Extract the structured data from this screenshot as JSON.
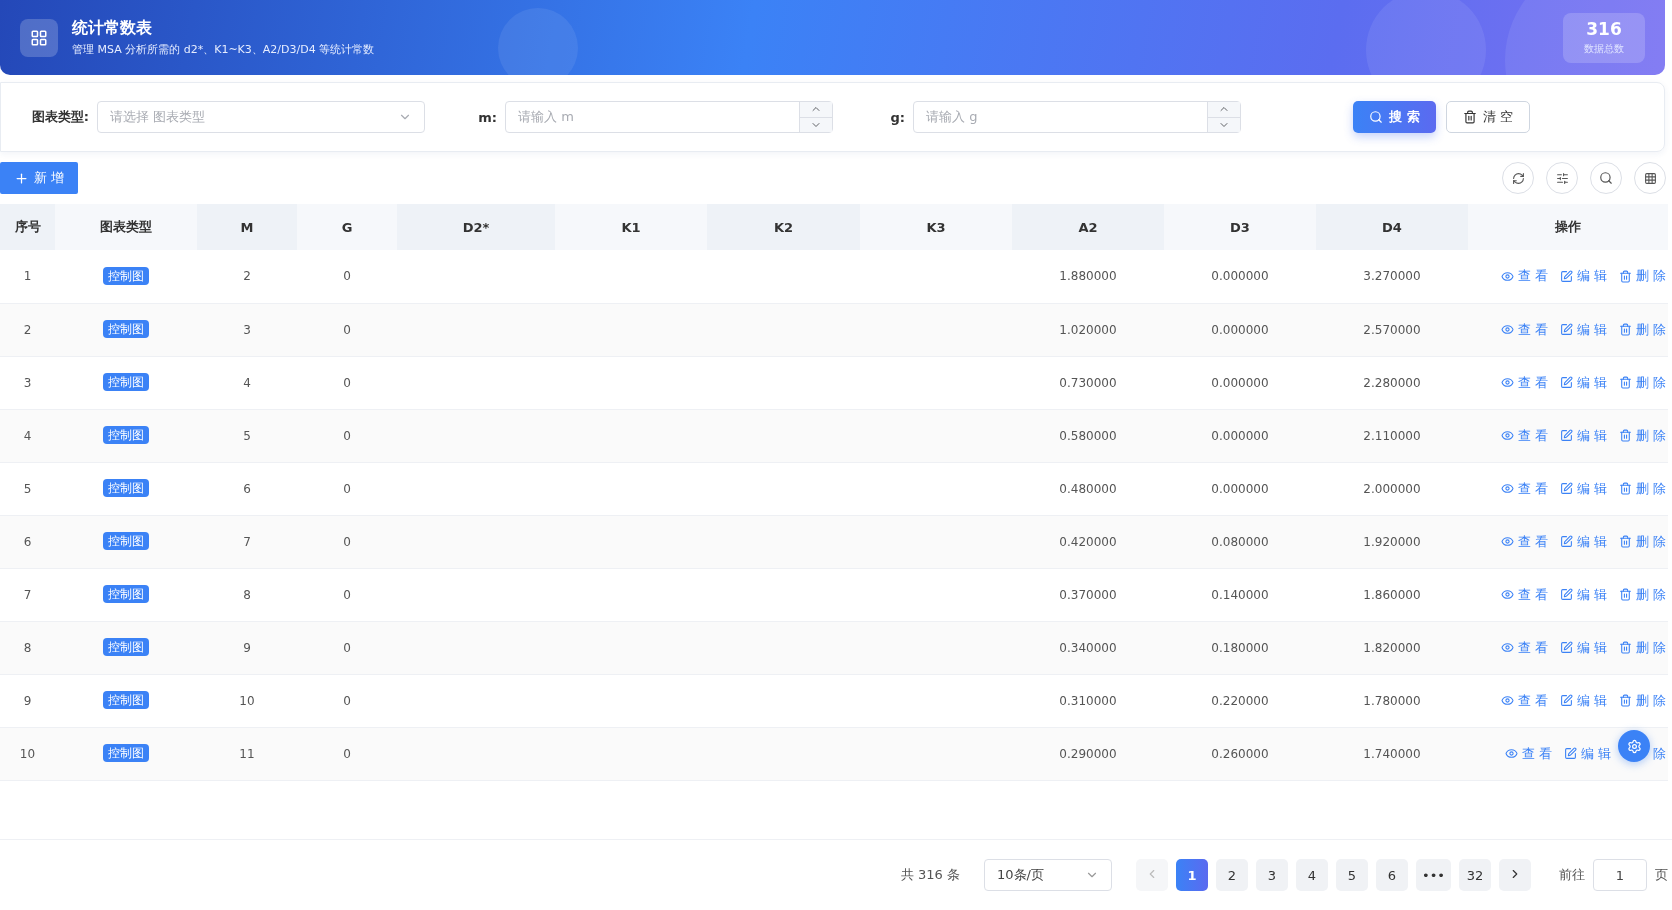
{
  "header": {
    "title": "统计常数表",
    "subtitle": "管理 MSA 分析所需的 d2*、K1~K3、A2/D3/D4 等统计常数",
    "stat_value": "316",
    "stat_label": "数据总数"
  },
  "filters": [
    {
      "kind": "select",
      "label": "图表类型:",
      "placeholder": "请选择 图表类型"
    },
    {
      "kind": "number",
      "label": "m:",
      "placeholder": "请输入 m"
    },
    {
      "kind": "number",
      "label": "g:",
      "placeholder": "请输入 g"
    }
  ],
  "search_button": "搜 索",
  "clear_button": "清 空",
  "add_button": "新 增",
  "table": {
    "columns": [
      "序号",
      "图表类型",
      "M",
      "G",
      "D2*",
      "K1",
      "K2",
      "K3",
      "A2",
      "D3",
      "D4",
      "操作"
    ],
    "rows": [
      {
        "cells": [
          "1",
          "控制图",
          "2",
          "0",
          "",
          "",
          "",
          "",
          "1.880000",
          "0.000000",
          "3.270000"
        ],
        "actions": [
          {
            "kind": "view",
            "label": "查 看",
            "covered": false
          },
          {
            "kind": "edit",
            "label": "编 辑",
            "covered": false
          },
          {
            "kind": "delete",
            "label": "删 除",
            "covered": false
          }
        ]
      },
      {
        "cells": [
          "2",
          "控制图",
          "3",
          "0",
          "",
          "",
          "",
          "",
          "1.020000",
          "0.000000",
          "2.570000"
        ],
        "actions": [
          {
            "kind": "view",
            "label": "查 看",
            "covered": false
          },
          {
            "kind": "edit",
            "label": "编 辑",
            "covered": false
          },
          {
            "kind": "delete",
            "label": "删 除",
            "covered": false
          }
        ]
      },
      {
        "cells": [
          "3",
          "控制图",
          "4",
          "0",
          "",
          "",
          "",
          "",
          "0.730000",
          "0.000000",
          "2.280000"
        ],
        "actions": [
          {
            "kind": "view",
            "label": "查 看",
            "covered": false
          },
          {
            "kind": "edit",
            "label": "编 辑",
            "covered": false
          },
          {
            "kind": "delete",
            "label": "删 除",
            "covered": false
          }
        ]
      },
      {
        "cells": [
          "4",
          "控制图",
          "5",
          "0",
          "",
          "",
          "",
          "",
          "0.580000",
          "0.000000",
          "2.110000"
        ],
        "actions": [
          {
            "kind": "view",
            "label": "查 看",
            "covered": false
          },
          {
            "kind": "edit",
            "label": "编 辑",
            "covered": false
          },
          {
            "kind": "delete",
            "label": "删 除",
            "covered": false
          }
        ]
      },
      {
        "cells": [
          "5",
          "控制图",
          "6",
          "0",
          "",
          "",
          "",
          "",
          "0.480000",
          "0.000000",
          "2.000000"
        ],
        "actions": [
          {
            "kind": "view",
            "label": "查 看",
            "covered": false
          },
          {
            "kind": "edit",
            "label": "编 辑",
            "covered": false
          },
          {
            "kind": "delete",
            "label": "删 除",
            "covered": false
          }
        ]
      },
      {
        "cells": [
          "6",
          "控制图",
          "7",
          "0",
          "",
          "",
          "",
          "",
          "0.420000",
          "0.080000",
          "1.920000"
        ],
        "actions": [
          {
            "kind": "view",
            "label": "查 看",
            "covered": false
          },
          {
            "kind": "edit",
            "label": "编 辑",
            "covered": false
          },
          {
            "kind": "delete",
            "label": "删 除",
            "covered": false
          }
        ]
      },
      {
        "cells": [
          "7",
          "控制图",
          "8",
          "0",
          "",
          "",
          "",
          "",
          "0.370000",
          "0.140000",
          "1.860000"
        ],
        "actions": [
          {
            "kind": "view",
            "label": "查 看",
            "covered": false
          },
          {
            "kind": "edit",
            "label": "编 辑",
            "covered": false
          },
          {
            "kind": "delete",
            "label": "删 除",
            "covered": false
          }
        ]
      },
      {
        "cells": [
          "8",
          "控制图",
          "9",
          "0",
          "",
          "",
          "",
          "",
          "0.340000",
          "0.180000",
          "1.820000"
        ],
        "actions": [
          {
            "kind": "view",
            "label": "查 看",
            "covered": false
          },
          {
            "kind": "edit",
            "label": "编 辑",
            "covered": false
          },
          {
            "kind": "delete",
            "label": "删 除",
            "covered": false
          }
        ]
      },
      {
        "cells": [
          "9",
          "控制图",
          "10",
          "0",
          "",
          "",
          "",
          "",
          "0.310000",
          "0.220000",
          "1.780000"
        ],
        "actions": [
          {
            "kind": "view",
            "label": "查 看",
            "covered": false
          },
          {
            "kind": "edit",
            "label": "编 辑",
            "covered": false
          },
          {
            "kind": "delete",
            "label": "删 除",
            "covered": false
          }
        ]
      },
      {
        "cells": [
          "10",
          "控制图",
          "11",
          "0",
          "",
          "",
          "",
          "",
          "0.290000",
          "0.260000",
          "1.740000"
        ],
        "actions": [
          {
            "kind": "view",
            "label": "查 看",
            "covered": false
          },
          {
            "kind": "edit",
            "label": "编 辑",
            "covered": false
          },
          {
            "kind": "delete",
            "label": "除",
            "covered": true
          }
        ]
      }
    ]
  },
  "pagination": {
    "total": "共 316 条",
    "page_size": "10条/页",
    "pages": [
      {
        "label": "1",
        "selected": true
      },
      {
        "label": "2",
        "selected": false
      },
      {
        "label": "3",
        "selected": false
      },
      {
        "label": "4",
        "selected": false
      },
      {
        "label": "5",
        "selected": false
      },
      {
        "label": "6",
        "selected": false
      },
      {
        "label": "•••",
        "selected": false
      },
      {
        "label": "32",
        "selected": false
      }
    ],
    "goto_label": "前往",
    "goto_value": "1",
    "page_unit": "页"
  }
}
